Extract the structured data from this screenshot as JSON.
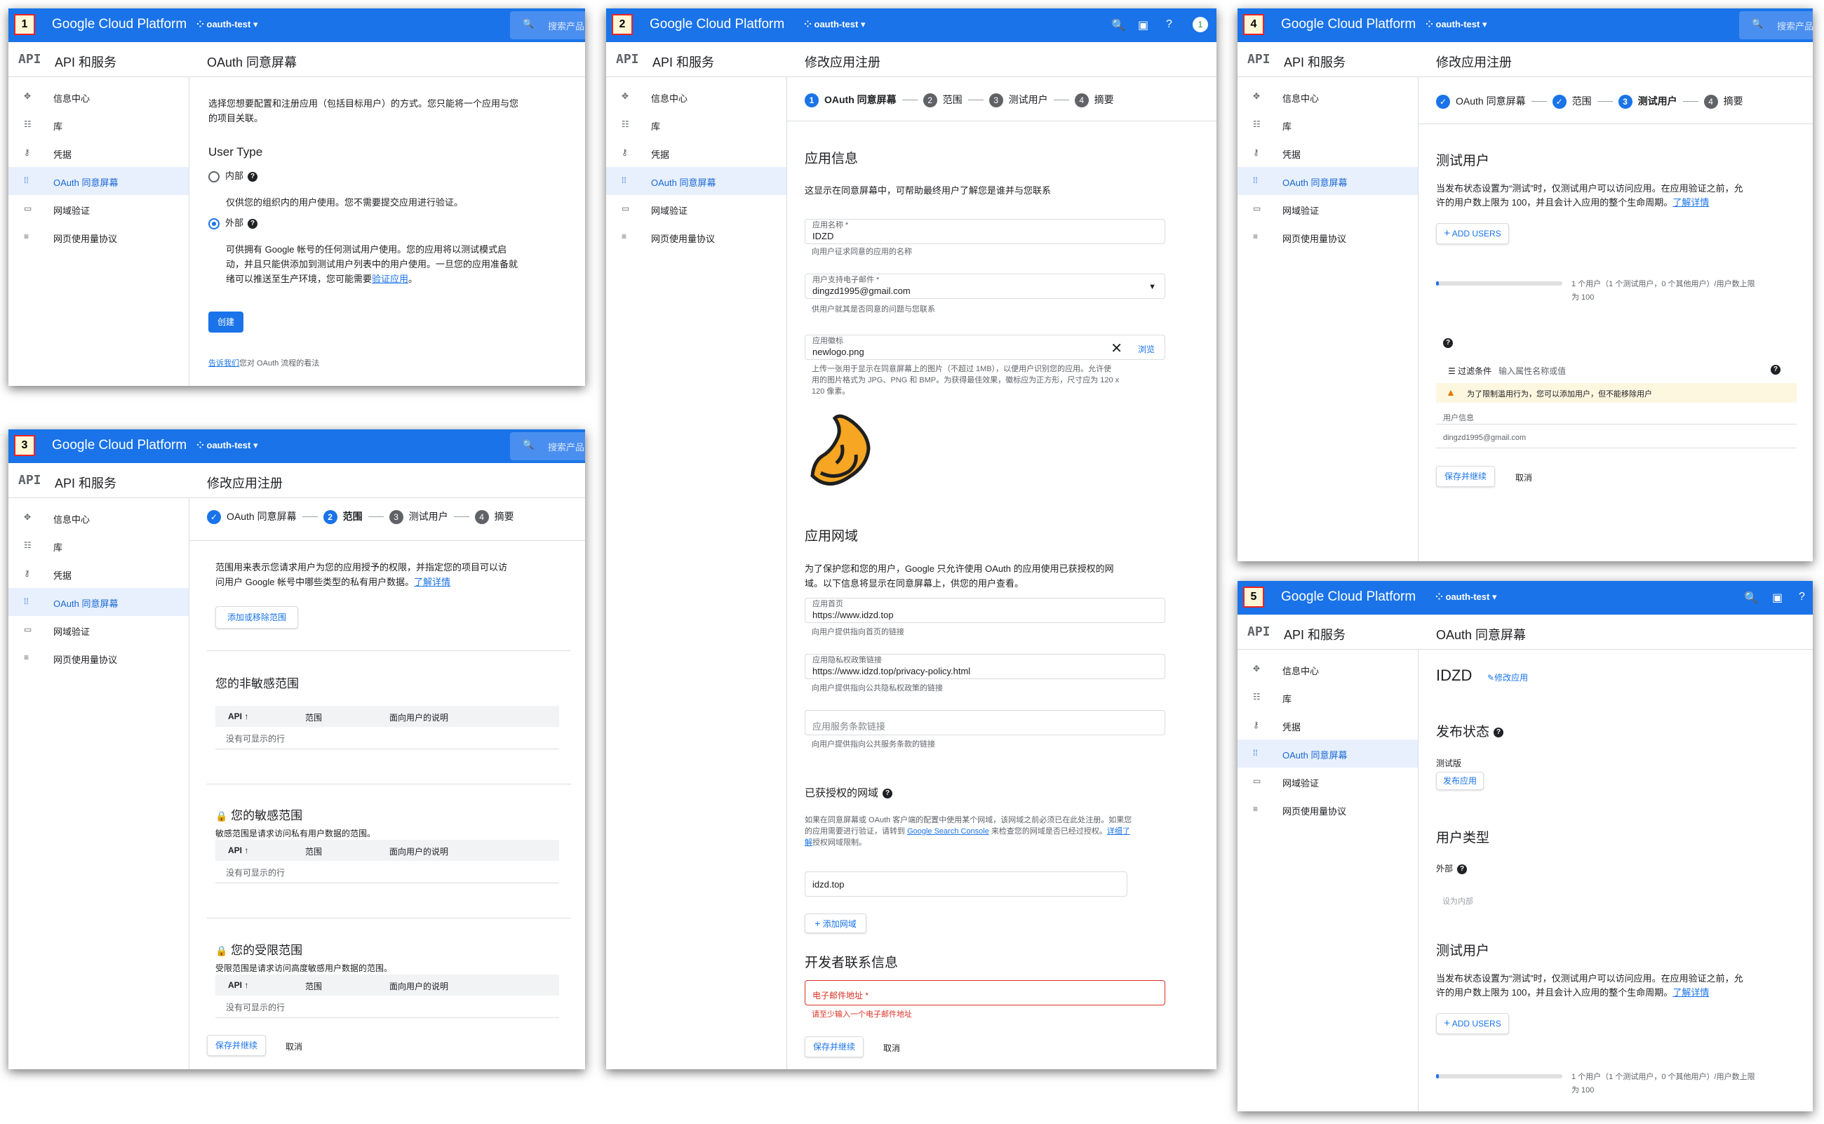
{
  "common": {
    "brand": "Google Cloud Platform",
    "project": "oauth-test",
    "search_placeholder": "搜索产品",
    "api_logo": "API",
    "service": "API 和服务",
    "nav": [
      "信息中心",
      "库",
      "凭据",
      "OAuth 同意屏幕",
      "网域验证",
      "网页使用量协议"
    ],
    "nav_icons": [
      "dashboard-icon",
      "library-icon",
      "key-icon",
      "consent-icon",
      "domain-icon",
      "agreement-icon"
    ],
    "accent": "#1a73e8"
  },
  "p1": {
    "badge": "1",
    "title": "OAuth 同意屏幕",
    "intro1": "选择您想要配置和注册应用（包括目标用户）的方式。您只能将一个应用与您",
    "intro2": "的项目关联。",
    "user_type": "User Type",
    "internal": "内部",
    "internal_desc": "仅供您的组织内的用户使用。您不需要提交应用进行验证。",
    "external": "外部",
    "ext1": "可供拥有 Google 帐号的任何测试用户使用。您的应用将以测试模式启",
    "ext2": "动，并且只能供添加到测试用户列表中的用户使用。一旦您的应用准备就",
    "ext3a": "绪可以推送至生产环境，您可能需要",
    "ext3link": "验证应用",
    "ext3b": "。",
    "create": "创建",
    "feedback_link": "告诉我们",
    "feedback": "您对 OAuth 流程的看法"
  },
  "p2": {
    "badge": "2",
    "title": "修改应用注册",
    "steps": [
      "OAuth 同意屏幕",
      "范围",
      "测试用户",
      "摘要"
    ],
    "app_info": "应用信息",
    "app_info_desc": "这显示在同意屏幕中，可帮助最终用户了解您是谁并与您联系",
    "app_name_label": "应用名称 *",
    "app_name": "IDZD",
    "app_name_hint": "向用户征求同意的应用的名称",
    "email_label": "用户支持电子邮件 *",
    "email": "dingzd1995@gmail.com",
    "email_hint": "供用户就其是否同意的问题与您联系",
    "logo_label": "应用徽标",
    "logo_file": "newlogo.png",
    "browse": "浏览",
    "logo_hint1": "上传一张用于显示在同意屏幕上的图片（不超过 1MB），以便用户识别您的应用。允许使",
    "logo_hint2": "用的图片格式为 JPG、PNG 和 BMP。为获得最佳效果，徽标应为正方形，尺寸应为 120 x",
    "logo_hint3": "120 像素。",
    "domain": "应用网域",
    "domain_desc1": "为了保护您和您的用户，Google 只允许使用 OAuth 的应用使用已获授权的网",
    "domain_desc2": "域。以下信息将显示在同意屏幕上，供您的用户查看。",
    "home_label": "应用首页",
    "home": "https://www.idzd.top",
    "home_hint": "向用户提供指向首页的链接",
    "privacy_label": "应用隐私权政策链接",
    "privacy": "https://www.idzd.top/privacy-policy.html",
    "privacy_hint": "向用户提供指向公共隐私权政策的链接",
    "tos_ph": "应用服务条款链接",
    "tos_hint": "向用户提供指向公共服务条款的链接",
    "auth_domains": "已获授权的网域",
    "auth_desc1": "如果在同意屏幕或 OAuth 客户端的配置中使用某个网域，该网域之前必须已在此处注册。如果您",
    "auth_desc2a": "的应用需要进行验证，请转到 ",
    "auth_link": "Google Search Console",
    "auth_desc2b": " 来检查您的网域是否已经过授权。",
    "auth_more": "详细了",
    "auth_desc3": "解",
    "auth_desc3b": "授权网域限制。",
    "domain_value": "idzd.top",
    "add_domain": "添加网域",
    "dev": "开发者联系信息",
    "dev_ph": "电子邮件地址 *",
    "dev_error": "请至少输入一个电子邮件地址",
    "save": "保存并继续",
    "cancel": "取消",
    "error_color": "#d93025"
  },
  "p3": {
    "badge": "3",
    "title": "修改应用注册",
    "steps": [
      "OAuth 同意屏幕",
      "范围",
      "测试用户",
      "摘要"
    ],
    "desc1": "范围用来表示您请求用户为您的应用授予的权限，并指定您的项目可以访",
    "desc2a": "问用户 Google 帐号中哪些类型的私有用户数据。",
    "learn": "了解详情",
    "add_remove": "添加或移除范围",
    "nonsensitive": "您的非敏感范围",
    "sensitive": "您的敏感范围",
    "sensitive_desc": "敏感范围是请求访问私有用户数据的范围。",
    "restricted": "您的受限范围",
    "restricted_desc": "受限范围是请求访问高度敏感用户数据的范围。",
    "cols": [
      "API",
      "范围",
      "面向用户的说明"
    ],
    "empty": "没有可显示的行",
    "save": "保存并继续",
    "cancel": "取消"
  },
  "p4": {
    "badge": "4",
    "title": "修改应用注册",
    "steps": [
      "OAuth 同意屏幕",
      "范围",
      "测试用户",
      "摘要"
    ],
    "section": "测试用户",
    "desc1": "当发布状态设置为“测试”时，仅测试用户可以访问应用。在应用验证之前，允",
    "desc2a": "许的用户数上限为 100，并且会计入应用的整个生命周期。",
    "learn": "了解详情",
    "add_users": "ADD USERS",
    "count1": "1 个用户（1 个测试用户，0 个其他用户）/用户数上限",
    "count2": "为 100",
    "user_fraction": 0.01,
    "filter": "过滤条件",
    "filter_ph": "输入属性名称或值",
    "warning": "为了限制滥用行为，您可以添加用户，但不能移除用户",
    "col": "用户信息",
    "user": "dingzd1995@gmail.com",
    "save": "保存并继续",
    "cancel": "取消",
    "warning_bg": "#fef7e0"
  },
  "p5": {
    "badge": "5",
    "title": "OAuth 同意屏幕",
    "app": "IDZD",
    "edit": "修改应用",
    "pub": "发布状态",
    "pub_value": "测试版",
    "publish": "发布应用",
    "ut": "用户类型",
    "ut_value": "外部",
    "make_internal": "设为内部",
    "tu": "测试用户",
    "desc1": "当发布状态设置为“测试”时，仅测试用户可以访问应用。在应用验证之前，允",
    "desc2a": "许的用户数上限为 100，并且会计入应用的整个生命周期。",
    "learn": "了解详情",
    "add_users": "ADD USERS",
    "count1": "1 个用户（1 个测试用户，0 个其他用户）/用户数上限",
    "count2": "为 100"
  }
}
